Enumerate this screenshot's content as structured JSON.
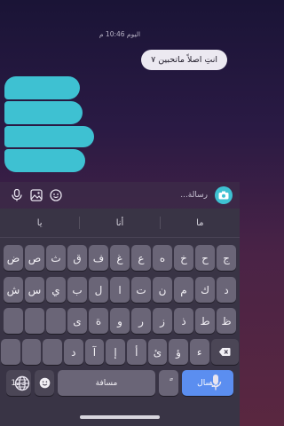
{
  "chat": {
    "timestamp": "اليوم 10:46 م",
    "outgoing_message": "انتِ اصلاً ماتحبين ٧"
  },
  "composer": {
    "placeholder": "رسالة..."
  },
  "keyboard": {
    "suggestions": [
      "ما",
      "أنا",
      "يا"
    ],
    "row1": [
      "ج",
      "ح",
      "خ",
      "ه",
      "ع",
      "غ",
      "ف",
      "ق",
      "ث",
      "ص",
      "ض"
    ],
    "row2": [
      "د",
      "ك",
      "م",
      "ن",
      "ت",
      "ا",
      "ل",
      "ب",
      "ي",
      "س",
      "ش"
    ],
    "row3": [
      "ظ",
      "ط",
      "ذ",
      "ز",
      "ر",
      "و",
      "ة",
      "ى"
    ],
    "row4": [
      "ء",
      "ؤ",
      "ئ",
      "أ",
      "إ",
      "آ",
      "د"
    ],
    "space_label": "مسافة",
    "numbers_label": "123",
    "send_label": "إرسال",
    "diacritic_label": "ً"
  },
  "icons": {
    "mic": "microphone-icon",
    "gallery": "image-icon",
    "sticker": "sticker-icon",
    "camera": "camera-icon",
    "backspace": "backspace-icon",
    "globe": "globe-icon",
    "emoji": "emoji-icon"
  },
  "colors": {
    "accent": "#3ec1d2",
    "send": "#5b8ef0"
  }
}
